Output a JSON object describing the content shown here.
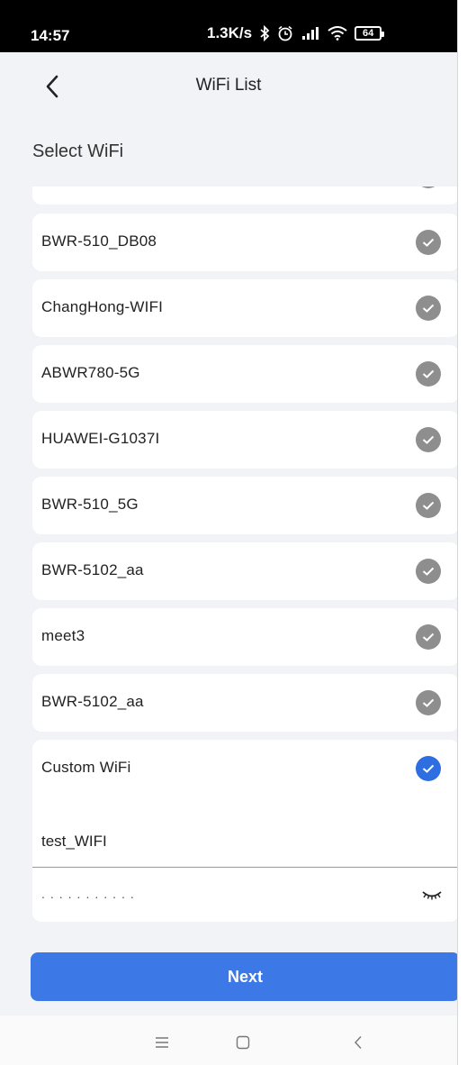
{
  "status_bar": {
    "time": "14:57",
    "net_speed": "1.3K/s",
    "battery": "64"
  },
  "header": {
    "title": "WiFi List",
    "back_icon": "chevron-left-icon"
  },
  "section_title": "Select WiFi",
  "wifi_list": [
    {
      "name": "BWR-510_DB08"
    },
    {
      "name": "ChangHong-WIFI"
    },
    {
      "name": "ABWR780-5G"
    },
    {
      "name": "HUAWEI-G1037I"
    },
    {
      "name": "BWR-510_5G"
    },
    {
      "name": "BWR-5102_aa"
    },
    {
      "name": "meet3"
    },
    {
      "name": "BWR-5102_aa"
    }
  ],
  "custom_wifi": {
    "label": "Custom WiFi",
    "ssid": "test_WIFI",
    "password_masked": "...........",
    "selected": true
  },
  "next_button": {
    "label": "Next"
  },
  "colors": {
    "accent": "#3d79e6",
    "check_selected": "#2f6ee0",
    "check_unselected": "#8e8e8e",
    "background": "#f2f3f7"
  }
}
